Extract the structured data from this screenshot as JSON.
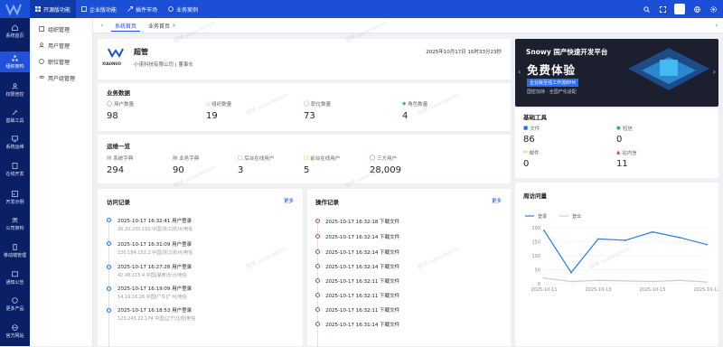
{
  "topnav": [
    {
      "label": "开源版功能",
      "icon": "grid-icon",
      "active": true
    },
    {
      "label": "企业版功能",
      "icon": "crown-icon",
      "active": false
    },
    {
      "label": "插件市场",
      "icon": "puzzle-icon",
      "active": false
    },
    {
      "label": "业务案例",
      "icon": "briefcase-icon",
      "active": false
    }
  ],
  "sidebar": [
    {
      "label": "系统首页"
    },
    {
      "label": "组织架构"
    },
    {
      "label": "权限管控"
    },
    {
      "label": "基础工具"
    },
    {
      "label": "系统运维"
    },
    {
      "label": "在线开发"
    },
    {
      "label": "开发示例"
    },
    {
      "label": "公司架构"
    },
    {
      "label": "移动端管理"
    },
    {
      "label": "通知公告"
    },
    {
      "label": "更多产品"
    },
    {
      "label": "官方网站"
    }
  ],
  "submenu": [
    {
      "label": "组织管理"
    },
    {
      "label": "用户管理"
    },
    {
      "label": "职位管理"
    },
    {
      "label": "用户组管理"
    }
  ],
  "tabs": {
    "home": "系统首页",
    "business": "业务首页"
  },
  "profile": {
    "name": "超管",
    "company": "小诺科技有限公司 | 董事长",
    "datetime": "2025年10月17日 16时33分23秒",
    "logo_text": "XIAONUO"
  },
  "business": {
    "title": "业务数据",
    "items": [
      {
        "label": "用户数量",
        "value": "98"
      },
      {
        "label": "组织数量",
        "value": "19"
      },
      {
        "label": "职位数量",
        "value": "73"
      },
      {
        "label": "角色数量",
        "value": "4"
      }
    ]
  },
  "ops": {
    "title": "运维一览",
    "items": [
      {
        "label": "系统字典",
        "value": "294"
      },
      {
        "label": "业务字典",
        "value": "90"
      },
      {
        "label": "后台在线用户",
        "value": "3"
      },
      {
        "label": "前台在线用户",
        "value": "5"
      },
      {
        "label": "三方用户",
        "value": "28,009"
      }
    ]
  },
  "visits": {
    "title": "访问记录",
    "more": "更多",
    "records": [
      {
        "time": "2025-10-17 16:32:41 用户登录",
        "sub": "36.20.200.150 中国|浙江|杭州|电信"
      },
      {
        "time": "2025-10-17 16:31:09 用户登录",
        "sub": "220.184.152.2 中国|浙江|杭州|电信"
      },
      {
        "time": "2025-10-17 16:27:28 用户登录",
        "sub": "42.48.115.4 中国|湖南|长沙|电信"
      },
      {
        "time": "2025-10-17 16:19:09 用户登录",
        "sub": "14.19.16.26 中国|广东|广州|电信"
      },
      {
        "time": "2025-10-17 16:18:53 用户登录",
        "sub": "123.245.22.174 中国|辽宁|沈阳|电信"
      }
    ]
  },
  "operations": {
    "title": "操作记录",
    "more": "更多",
    "records": [
      {
        "time": "2025-10-17 16:32:18 下载文件"
      },
      {
        "time": "2025-10-17 16:32:14 下载文件"
      },
      {
        "time": "2025-10-17 16:32:14 下载文件"
      },
      {
        "time": "2025-10-17 16:32:14 下载文件"
      },
      {
        "time": "2025-10-17 16:32:11 下载文件"
      },
      {
        "time": "2025-10-17 16:32:11 下载文件"
      },
      {
        "time": "2025-10-17 16:32:11 下载文件"
      },
      {
        "time": "2025-10-17 16:31:14 下载文件"
      }
    ]
  },
  "banner": {
    "line1": "Snowy 国产快速开发平台",
    "line2": "免费体验",
    "line3": "企业版至强工作流BPM",
    "line4": "国密加持 · 全国产化适配"
  },
  "tools": {
    "title": "基础工具",
    "items": [
      {
        "label": "文件",
        "value": "86",
        "icon": "file-icon",
        "color": "#1a6fe8"
      },
      {
        "label": "短信",
        "value": "0",
        "icon": "message-icon",
        "color": "#2eb872"
      },
      {
        "label": "邮件",
        "value": "0",
        "icon": "mail-icon",
        "color": "#f5a623"
      },
      {
        "label": "站内信",
        "value": "11",
        "icon": "bell-icon",
        "color": "#e53935"
      }
    ]
  },
  "weekly": {
    "title": "周访问量"
  },
  "chart_data": {
    "type": "line",
    "title": "周访问量",
    "x": [
      "2025-10-11",
      "2025-10-12",
      "2025-10-13",
      "2025-10-14",
      "2025-10-15",
      "2025-10-16",
      "2025-10-17"
    ],
    "x_tick_labels": [
      "2025-10-11",
      "2025-10-13",
      "2025-10-15",
      "2025-10-17"
    ],
    "series": [
      {
        "name": "登录",
        "values": [
          190,
          40,
          160,
          155,
          185,
          165,
          140
        ],
        "color": "#2a7ae8"
      },
      {
        "name": "登出",
        "values": [
          20,
          8,
          12,
          10,
          8,
          12,
          6
        ],
        "color": "#c8cdd6"
      }
    ],
    "y_ticks": [
      0,
      50,
      100,
      150,
      200
    ],
    "ylim": [
      0,
      200
    ],
    "legend": "top-left",
    "grid": true
  }
}
